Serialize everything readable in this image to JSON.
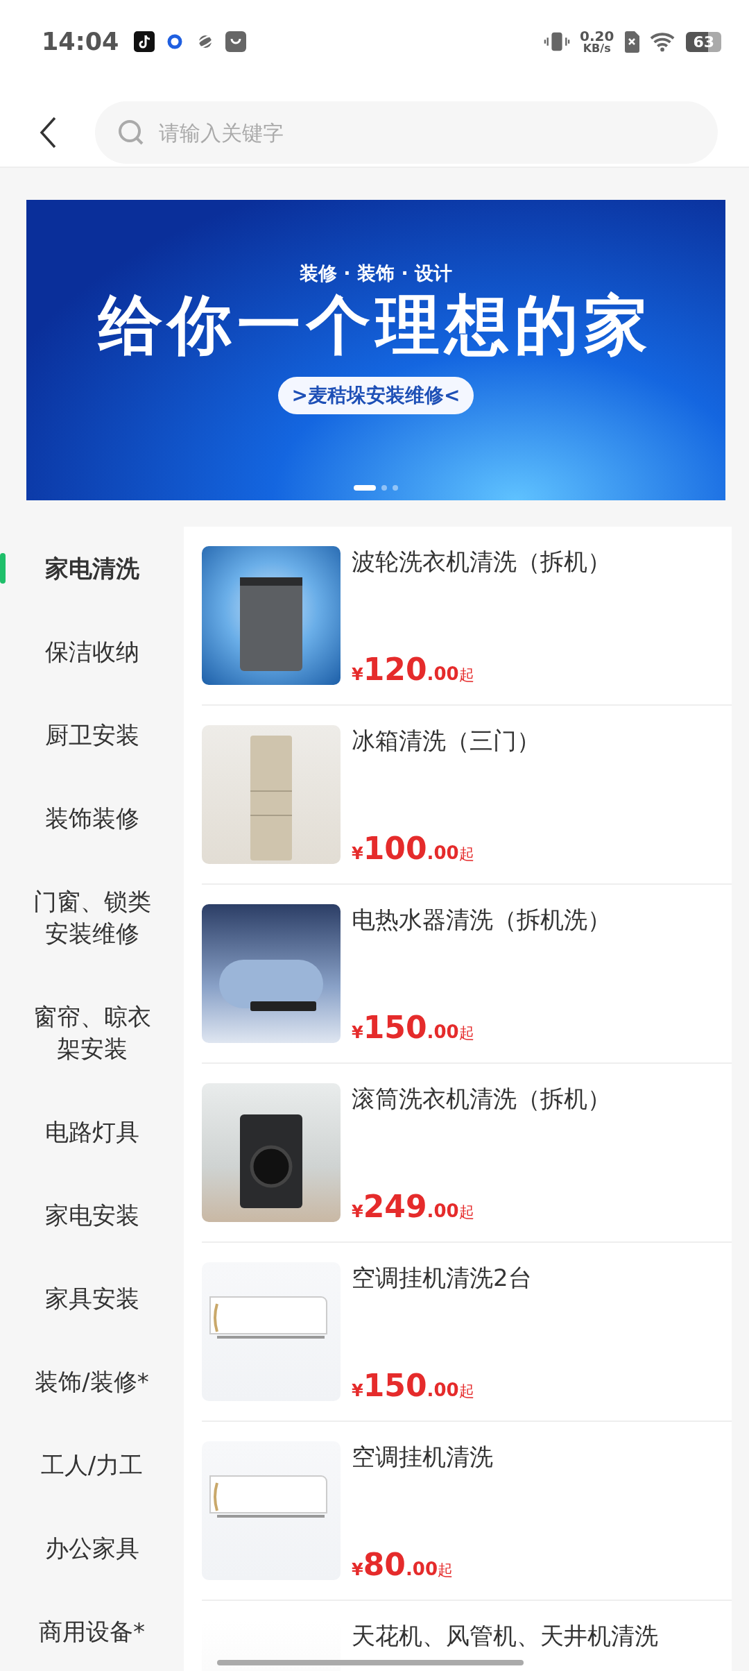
{
  "status_bar": {
    "time": "14:04",
    "net_speed_value": "0.20",
    "net_speed_unit": "KB/s",
    "battery": "63"
  },
  "search": {
    "placeholder": "请输入关键字"
  },
  "banner": {
    "subtitle": "装修 · 装饰 · 设计",
    "title": "给你一个理想的家",
    "tag": ">麦秸垛安装维修<",
    "slides": [
      {
        "selected": true
      },
      {
        "selected": false
      },
      {
        "selected": false
      }
    ]
  },
  "categories": [
    {
      "label": "家电清洗",
      "selected": true
    },
    {
      "label": "保洁收纳",
      "selected": false
    },
    {
      "label": "厨卫安装",
      "selected": false
    },
    {
      "label": "装饰装修",
      "selected": false
    },
    {
      "label": "门窗、锁类安装维修",
      "selected": false
    },
    {
      "label": "窗帘、晾衣架安装",
      "selected": false
    },
    {
      "label": "电路灯具",
      "selected": false
    },
    {
      "label": "家电安装",
      "selected": false
    },
    {
      "label": "家具安装",
      "selected": false
    },
    {
      "label": "装饰/装修*",
      "selected": false
    },
    {
      "label": "工人/力工",
      "selected": false
    },
    {
      "label": "办公家具",
      "selected": false
    },
    {
      "label": "商用设备*",
      "selected": false
    }
  ],
  "products": [
    {
      "title": "波轮洗衣机清洗（拆机）",
      "currency": "¥",
      "price": "120",
      "decimal": ".00",
      "suffix": "起",
      "kind": "top-loader"
    },
    {
      "title": "冰箱清洗（三门）",
      "currency": "¥",
      "price": "100",
      "decimal": ".00",
      "suffix": "起",
      "kind": "fridge"
    },
    {
      "title": "电热水器清洗（拆机洗）",
      "currency": "¥",
      "price": "150",
      "decimal": ".00",
      "suffix": "起",
      "kind": "heater"
    },
    {
      "title": "滚筒洗衣机清洗（拆机）",
      "currency": "¥",
      "price": "249",
      "decimal": ".00",
      "suffix": "起",
      "kind": "front-loader"
    },
    {
      "title": "空调挂机清洗2台",
      "currency": "¥",
      "price": "150",
      "decimal": ".00",
      "suffix": "起",
      "kind": "aircon"
    },
    {
      "title": "空调挂机清洗",
      "currency": "¥",
      "price": "80",
      "decimal": ".00",
      "suffix": "起",
      "kind": "aircon"
    },
    {
      "title": "天花机、风管机、天井机清洗",
      "kind": "ceiling"
    }
  ]
}
